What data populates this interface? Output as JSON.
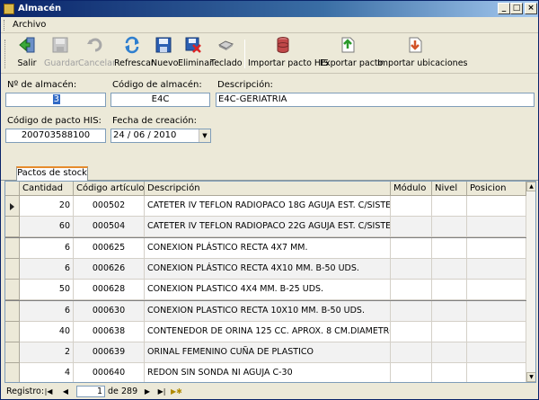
{
  "window": {
    "title": "Almacén"
  },
  "titlebar_buttons": {
    "min": "_",
    "max": "□",
    "close": "×"
  },
  "menu": {
    "items": [
      "Archivo"
    ]
  },
  "toolbar": [
    {
      "label": "Salir",
      "icon": "exit-icon",
      "enabled": true
    },
    {
      "label": "Guardar",
      "icon": "save-icon",
      "enabled": false
    },
    {
      "label": "Cancelar",
      "icon": "undo-icon",
      "enabled": false
    },
    {
      "label": "Refrescar",
      "icon": "refresh-icon",
      "enabled": true
    },
    {
      "label": "Nuevo",
      "icon": "new-icon",
      "enabled": true
    },
    {
      "label": "Eliminar",
      "icon": "delete-icon",
      "enabled": true
    },
    {
      "label": "Teclado",
      "icon": "keyboard-icon",
      "enabled": true
    },
    {
      "label": "Importar pacto HIS",
      "icon": "database-icon",
      "enabled": true
    },
    {
      "label": "Exportar pacto",
      "icon": "export-icon",
      "enabled": true
    },
    {
      "label": "Importar ubicaciones",
      "icon": "import-icon",
      "enabled": true
    }
  ],
  "form": {
    "num_almacen_label": "Nº de almacén:",
    "num_almacen_value": "3",
    "codigo_almacen_label": "Código de almacén:",
    "codigo_almacen_value": "E4C",
    "descripcion_label": "Descripción:",
    "descripcion_value": "E4C-GERIATRIA",
    "codigo_pacto_label": "Código de pacto HIS:",
    "codigo_pacto_value": "200703588100",
    "fecha_label": "Fecha de creación:",
    "fecha_value": "24 / 06 / 2010"
  },
  "tab": {
    "label": "Pactos de stock"
  },
  "grid": {
    "columns": [
      "Cantidad",
      "Código artículo",
      "Descripción",
      "Módulo",
      "Nivel",
      "Posicion"
    ],
    "rows": [
      [
        "20",
        "000502",
        "CATETER IV TEFLON RADIOPACO 18G AGUJA EST. C/SISTE",
        "",
        "",
        ""
      ],
      [
        "60",
        "000504",
        "CATETER IV TEFLON RADIOPACO 22G AGUJA EST. C/SISTE",
        "",
        "",
        ""
      ],
      [
        "6",
        "000625",
        "CONEXION PLÁSTICO RECTA 4X7 MM.",
        "",
        "",
        ""
      ],
      [
        "6",
        "000626",
        "CONEXION PLÁSTICO RECTA 4X10 MM. B-50 UDS.",
        "",
        "",
        ""
      ],
      [
        "50",
        "000628",
        "CONEXION PLASTICO 4X4 MM. B-25 UDS.",
        "",
        "",
        ""
      ],
      [
        "6",
        "000630",
        "CONEXION PLASTICO RECTA 10X10 MM. B-50 UDS.",
        "",
        "",
        ""
      ],
      [
        "40",
        "000638",
        "CONTENEDOR DE ORINA 125 CC. APROX. 8 CM.DIAMETRO",
        "",
        "",
        ""
      ],
      [
        "2",
        "000639",
        "ORINAL FEMENINO CUÑA DE PLASTICO",
        "",
        "",
        ""
      ],
      [
        "4",
        "000640",
        "REDON SIN SONDA NI AGUJA C-30",
        "",
        "",
        ""
      ]
    ]
  },
  "navigator": {
    "label": "Registro:",
    "current": "1",
    "of_label": "de",
    "total": "289"
  }
}
